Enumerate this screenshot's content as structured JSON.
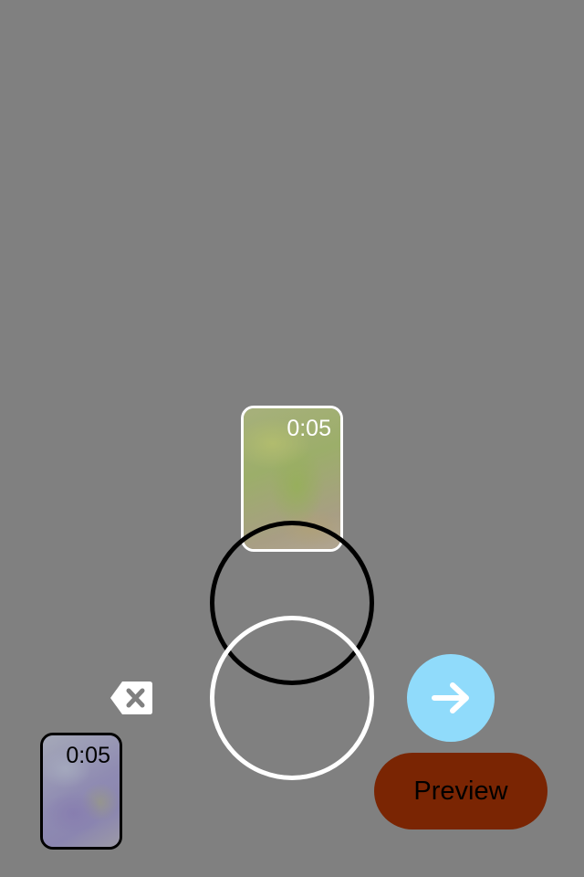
{
  "clips": {
    "current": {
      "duration": "0:05",
      "image": "moss-rock-thumbnail"
    },
    "recorded": {
      "duration": "0:05",
      "image": "purple-rock-thumbnail"
    }
  },
  "controls": {
    "delete_icon": "backspace-icon",
    "next_icon": "arrow-right-icon",
    "preview_label": "Preview"
  },
  "colors": {
    "background": "#808080",
    "next_button": "#90dbfb",
    "preview_button": "#7a2503"
  }
}
